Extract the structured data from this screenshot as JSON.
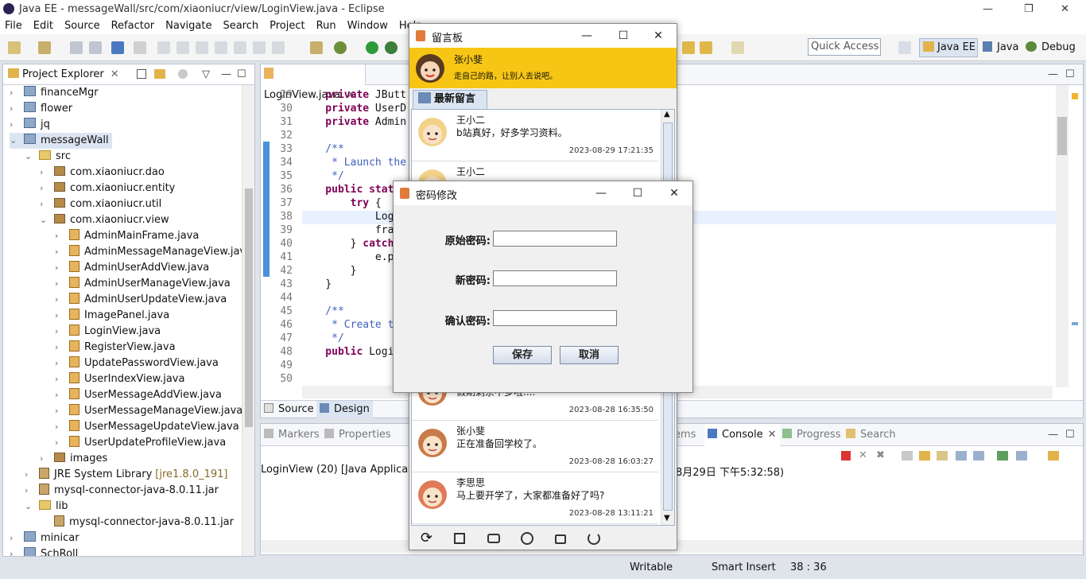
{
  "window": {
    "title": "Java EE - messageWall/src/com/xiaoniucr/view/LoginView.java - Eclipse"
  },
  "menu": [
    "File",
    "Edit",
    "Source",
    "Refactor",
    "Navigate",
    "Search",
    "Project",
    "Run",
    "Window",
    "Help"
  ],
  "toolbar": {
    "quick_access": "Quick Access",
    "perspectives": [
      "Java EE",
      "Java",
      "Debug"
    ]
  },
  "project_explorer": {
    "title": "Project Explorer",
    "items": [
      {
        "label": "financeMgr",
        "type": "proj",
        "level": 0,
        "tw": "›"
      },
      {
        "label": "flower",
        "type": "proj",
        "level": 0,
        "tw": "›"
      },
      {
        "label": "jq",
        "type": "proj",
        "level": 0,
        "tw": "›"
      },
      {
        "label": "messageWall",
        "type": "proj",
        "level": 0,
        "tw": "⌄",
        "selected": true
      },
      {
        "label": "src",
        "type": "fold",
        "level": 1,
        "tw": "⌄"
      },
      {
        "label": "com.xiaoniucr.dao",
        "type": "pkg",
        "level": 2,
        "tw": "›"
      },
      {
        "label": "com.xiaoniucr.entity",
        "type": "pkg",
        "level": 2,
        "tw": "›"
      },
      {
        "label": "com.xiaoniucr.util",
        "type": "pkg",
        "level": 2,
        "tw": "›"
      },
      {
        "label": "com.xiaoniucr.view",
        "type": "pkg",
        "level": 2,
        "tw": "⌄"
      },
      {
        "label": "AdminMainFrame.java",
        "type": "java",
        "level": 3,
        "tw": "›"
      },
      {
        "label": "AdminMessageManageView.java",
        "type": "java",
        "level": 3,
        "tw": "›"
      },
      {
        "label": "AdminUserAddView.java",
        "type": "java",
        "level": 3,
        "tw": "›"
      },
      {
        "label": "AdminUserManageView.java",
        "type": "java",
        "level": 3,
        "tw": "›"
      },
      {
        "label": "AdminUserUpdateView.java",
        "type": "java",
        "level": 3,
        "tw": "›"
      },
      {
        "label": "ImagePanel.java",
        "type": "java",
        "level": 3,
        "tw": "›"
      },
      {
        "label": "LoginView.java",
        "type": "java",
        "level": 3,
        "tw": "›"
      },
      {
        "label": "RegisterView.java",
        "type": "java",
        "level": 3,
        "tw": "›"
      },
      {
        "label": "UpdatePasswordView.java",
        "type": "java",
        "level": 3,
        "tw": "›"
      },
      {
        "label": "UserIndexView.java",
        "type": "java",
        "level": 3,
        "tw": "›"
      },
      {
        "label": "UserMessageAddView.java",
        "type": "java",
        "level": 3,
        "tw": "›"
      },
      {
        "label": "UserMessageManageView.java",
        "type": "java",
        "level": 3,
        "tw": "›"
      },
      {
        "label": "UserMessageUpdateView.java",
        "type": "java",
        "level": 3,
        "tw": "›"
      },
      {
        "label": "UserUpdateProfileView.java",
        "type": "java",
        "level": 3,
        "tw": "›"
      },
      {
        "label": "images",
        "type": "pkg",
        "level": 2,
        "tw": "›"
      },
      {
        "label": "JRE System Library",
        "suffix": "[jre1.8.0_191]",
        "type": "jar",
        "level": 1,
        "tw": "›"
      },
      {
        "label": "mysql-connector-java-8.0.11.jar",
        "type": "jar",
        "level": 1,
        "tw": "›"
      },
      {
        "label": "lib",
        "type": "fold",
        "level": 1,
        "tw": "⌄"
      },
      {
        "label": "mysql-connector-java-8.0.11.jar",
        "type": "jar",
        "level": 2,
        "tw": ""
      },
      {
        "label": "minicar",
        "type": "proj",
        "level": 0,
        "tw": "›"
      },
      {
        "label": "SchRoll",
        "type": "proj",
        "level": 0,
        "tw": "›"
      }
    ]
  },
  "editor": {
    "tab": "LoginView.java",
    "lines": [
      {
        "n": "29",
        "code": [
          [
            "kw",
            "    private "
          ],
          [
            "t",
            "JButt"
          ]
        ]
      },
      {
        "n": "30",
        "code": [
          [
            "kw",
            "    private "
          ],
          [
            "t",
            "UserD"
          ]
        ]
      },
      {
        "n": "31",
        "code": [
          [
            "kw",
            "    private "
          ],
          [
            "t",
            "Admin"
          ]
        ]
      },
      {
        "n": "32",
        "code": []
      },
      {
        "n": "33",
        "code": [
          [
            "cm",
            "    /**"
          ]
        ]
      },
      {
        "n": "34",
        "code": [
          [
            "cm",
            "     * Launch the"
          ]
        ]
      },
      {
        "n": "35",
        "code": [
          [
            "cm",
            "     */"
          ]
        ]
      },
      {
        "n": "36",
        "code": [
          [
            "kw",
            "    public stat"
          ]
        ]
      },
      {
        "n": "37",
        "code": [
          [
            "kw",
            "        try "
          ],
          [
            "t",
            "{"
          ]
        ]
      },
      {
        "n": "38",
        "code": [
          [
            "t",
            "            Log"
          ]
        ]
      },
      {
        "n": "39",
        "code": [
          [
            "t",
            "            fra"
          ]
        ]
      },
      {
        "n": "40",
        "code": [
          [
            "t",
            "        } "
          ],
          [
            "kw",
            "catch"
          ]
        ]
      },
      {
        "n": "41",
        "code": [
          [
            "t",
            "            e.p"
          ]
        ]
      },
      {
        "n": "42",
        "code": [
          [
            "t",
            "        }"
          ]
        ]
      },
      {
        "n": "43",
        "code": [
          [
            "t",
            "    }"
          ]
        ]
      },
      {
        "n": "44",
        "code": []
      },
      {
        "n": "45",
        "code": [
          [
            "cm",
            "    /**"
          ]
        ]
      },
      {
        "n": "46",
        "code": [
          [
            "cm",
            "     * Create t"
          ]
        ]
      },
      {
        "n": "47",
        "code": [
          [
            "cm",
            "     */"
          ]
        ]
      },
      {
        "n": "48",
        "code": [
          [
            "kw",
            "    public "
          ],
          [
            "t",
            "Logi"
          ]
        ]
      },
      {
        "n": "49",
        "code": []
      },
      {
        "n": "50",
        "code": []
      }
    ],
    "bottom_tabs": [
      "Source",
      "Design"
    ]
  },
  "bottom_panel": {
    "tabs": [
      "Markers",
      "Properties",
      "ems",
      "Console",
      "Progress",
      "Search"
    ],
    "console_text": "LoginView (20) [Java Application",
    "console_text_tail": "8月29日 下午5:32:58)"
  },
  "status": {
    "writable": "Writable",
    "insert": "Smart Insert",
    "pos": "38 : 36"
  },
  "msgboard": {
    "title": "留言板",
    "user": "张小斐",
    "motto": "走自己的路，让别人去说吧。",
    "tab": "最新留言",
    "messages": [
      {
        "name": "王小二",
        "text": "b站真好，好多学习资料。",
        "time": "2023-08-29 17:21:35",
        "color": "#f2d28a"
      },
      {
        "name": "王小二",
        "text": "",
        "time": "",
        "color": "#f2d28a"
      },
      {
        "name": "",
        "text": "假期剩余不多啦....",
        "time": "2023-08-28 16:35:50",
        "color": "#c97a4a"
      },
      {
        "name": "张小斐",
        "text": "正在准备回学校了。",
        "time": "2023-08-28 16:03:27",
        "color": "#c97a4a"
      },
      {
        "name": "李思思",
        "text": "马上要开学了，大家都准备好了吗?",
        "time": "2023-08-28 13:11:21",
        "color": "#e07a5a"
      }
    ]
  },
  "pwd_dialog": {
    "title": "密码修改",
    "labels": [
      "原始密码:",
      "新密码:",
      "确认密码:"
    ],
    "save": "保存",
    "cancel": "取消"
  }
}
